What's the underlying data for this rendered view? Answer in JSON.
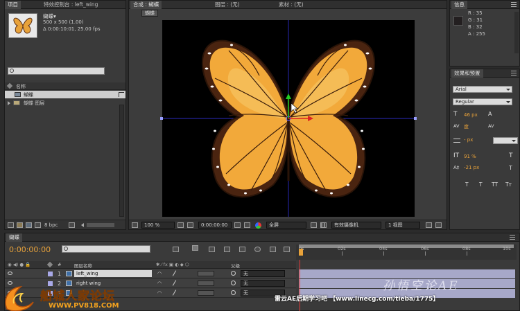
{
  "project": {
    "tab_project": "项目",
    "tab_effects": "特效控制台 : left_wing",
    "item_name": "蝴蝶▾",
    "item_size": "500 x 500 (1.00)",
    "item_duration": "Δ 0:00:10:01, 25.00 fps",
    "search_placeholder": "",
    "col_name": "名称",
    "items": [
      {
        "label": "蝴蝶",
        "kind": "composition"
      },
      {
        "label": "蝴蝶 图层",
        "kind": "folder"
      }
    ],
    "bpc": "8 bpc"
  },
  "comp": {
    "tab_comp": "合成 : 蝴蝶",
    "tab_layer": "图层 : (无)",
    "tab_footage": "素材 : (无)",
    "comp_chip": "蝴蝶",
    "zoom": "100 %",
    "timecode": "0:00:00:00",
    "resolution": "全屏",
    "camera": "有效摄像机",
    "views": "1 视图"
  },
  "info": {
    "tab": "信息",
    "R": "R : 35",
    "G": "G : 31",
    "B": "B : 32",
    "A": "A : 255"
  },
  "effects_presets": {
    "tab": "效果和预置"
  },
  "character": {
    "font": "Arial",
    "style": "Regular",
    "size": "46 px",
    "tracking_label": "度",
    "stroke": "- px",
    "vscale": "91 %",
    "baseline": "-21 px",
    "t_buttons": [
      "T",
      "T",
      "TT",
      "Tт"
    ]
  },
  "timeline": {
    "tab": "蝴蝶",
    "timecode": "0:00:00:00",
    "search_placeholder": "",
    "col_layer_name": "图层名称",
    "col_hash": "#",
    "col_parent": "父级",
    "ruler": [
      "0s",
      "02s",
      "04s",
      "06s",
      "08s",
      "10s"
    ],
    "layers": [
      {
        "num": "1",
        "name": "left_wing",
        "parent": "无"
      },
      {
        "num": "2",
        "name": "right wing",
        "parent": "无"
      },
      {
        "num": "3",
        "name": "",
        "parent": "无"
      }
    ]
  },
  "watermarks": {
    "forum_logo": "船城人家论坛",
    "forum_url": "WWW.PV818.COM",
    "bar_text": "雷云AE后期学习吧 【www.linecg.com/tieba/1775】",
    "stamp": "孙悟空论AE"
  },
  "colors": {
    "panel": "#3a3a3a",
    "orange": "#e8a23a",
    "wing": "#f2a93a",
    "wing_dark": "#5a2e14"
  }
}
